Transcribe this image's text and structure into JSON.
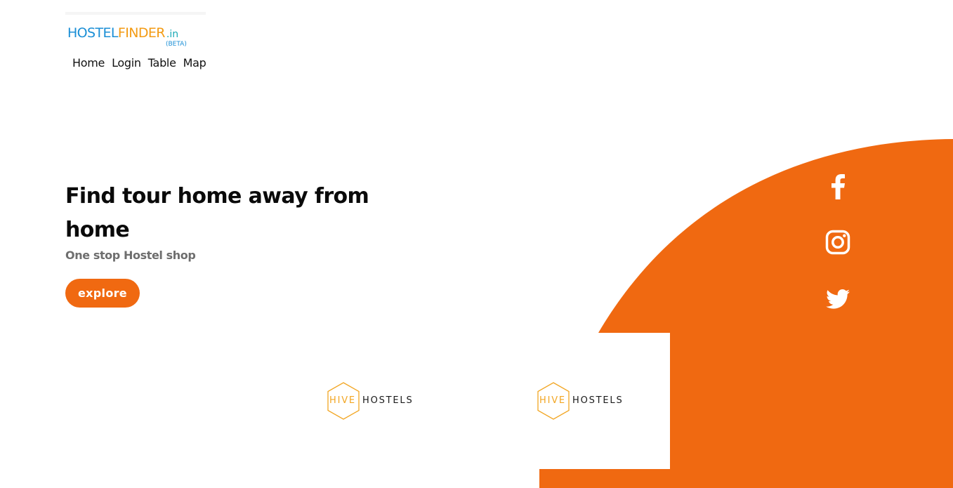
{
  "brand": {
    "logo_word1": "HOSTEL",
    "logo_word2": "FINDER",
    "logo_tld": ".in",
    "logo_tag": "(BETA)"
  },
  "nav": {
    "items": [
      {
        "label": "Home"
      },
      {
        "label": "Login"
      },
      {
        "label": "Table"
      },
      {
        "label": "Map"
      }
    ]
  },
  "hero": {
    "title": "Find tour home away from home",
    "subtitle": "One stop Hostel shop",
    "cta_label": "explore"
  },
  "social": [
    {
      "icon": "facebook-icon"
    },
    {
      "icon": "instagram-icon"
    },
    {
      "icon": "twitter-icon"
    }
  ],
  "partners": [
    {
      "name_part1": "HIVE",
      "name_part2": "HOSTELS"
    },
    {
      "name_part1": "HIVE",
      "name_part2": "HOSTELS"
    }
  ],
  "colors": {
    "accent": "#f06911",
    "logo_blue": "#1b8fd6",
    "logo_orange": "#f39b14",
    "hive_gold": "#f2a623",
    "text_dark": "#0a0a0a",
    "text_muted": "#6e6e6e"
  }
}
